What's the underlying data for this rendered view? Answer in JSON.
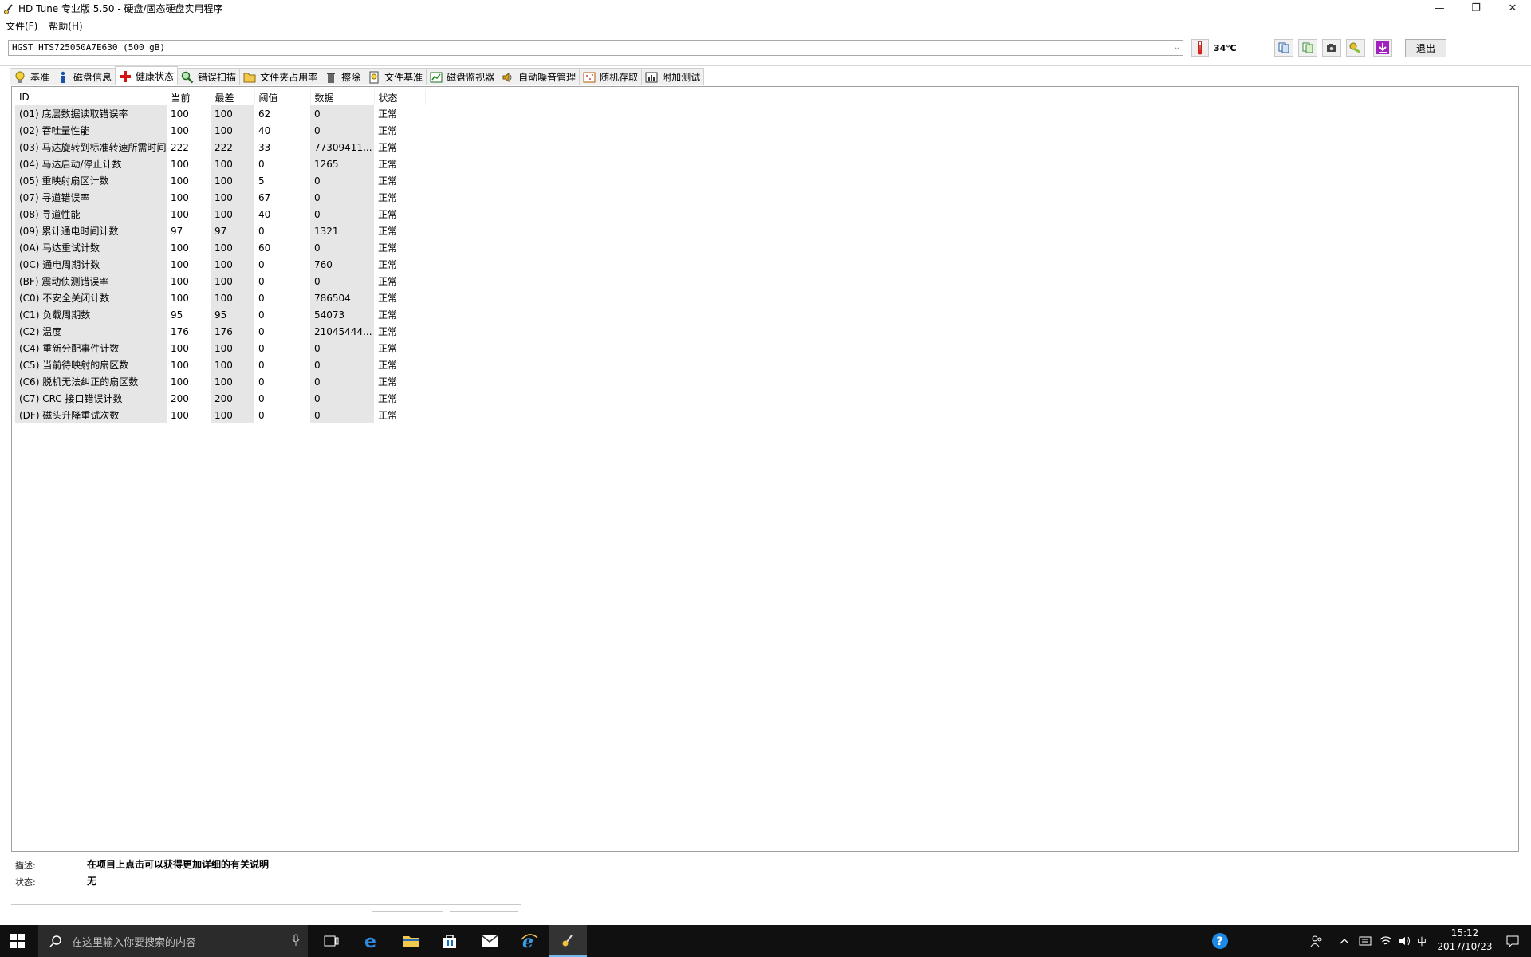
{
  "window": {
    "title": "HD Tune 专业版 5.50 - 硬盘/固态硬盘实用程序",
    "minimize_glyph": "—",
    "restore_glyph": "❐",
    "close_glyph": "✕"
  },
  "menu": {
    "file": "文件(F)",
    "help": "帮助(H)"
  },
  "drivebar": {
    "selected_drive": "HGST HTS725050A7E630 (500 gB)",
    "temperature": "34℃",
    "exit_label": "退出"
  },
  "tabs": [
    {
      "label": "基准",
      "icon": "lightbulb-icon"
    },
    {
      "label": "磁盘信息",
      "icon": "info-icon"
    },
    {
      "label": "健康状态",
      "icon": "red-cross-icon",
      "active": true
    },
    {
      "label": "错误扫描",
      "icon": "magnifier-icon"
    },
    {
      "label": "文件夹占用率",
      "icon": "folder-icon"
    },
    {
      "label": "擦除",
      "icon": "trash-icon"
    },
    {
      "label": "文件基准",
      "icon": "file-benchmark-icon"
    },
    {
      "label": "磁盘监视器",
      "icon": "monitor-chart-icon"
    },
    {
      "label": "自动噪音管理",
      "icon": "speaker-icon"
    },
    {
      "label": "随机存取",
      "icon": "random-access-icon"
    },
    {
      "label": "附加测试",
      "icon": "extra-tests-icon"
    }
  ],
  "table": {
    "headers": {
      "id": "ID",
      "current": "当前",
      "worst": "最差",
      "threshold": "阈值",
      "data": "数据",
      "status": "状态"
    },
    "rows": [
      {
        "id": "(01) 底层数据读取错误率",
        "current": "100",
        "worst": "100",
        "threshold": "62",
        "data": "0",
        "status": "正常"
      },
      {
        "id": "(02) 吞吐量性能",
        "current": "100",
        "worst": "100",
        "threshold": "40",
        "data": "0",
        "status": "正常"
      },
      {
        "id": "(03) 马达旋转到标准转速所需时间",
        "current": "222",
        "worst": "222",
        "threshold": "33",
        "data": "77309411...",
        "status": "正常"
      },
      {
        "id": "(04) 马达启动/停止计数",
        "current": "100",
        "worst": "100",
        "threshold": "0",
        "data": "1265",
        "status": "正常"
      },
      {
        "id": "(05) 重映射扇区计数",
        "current": "100",
        "worst": "100",
        "threshold": "5",
        "data": "0",
        "status": "正常"
      },
      {
        "id": "(07) 寻道错误率",
        "current": "100",
        "worst": "100",
        "threshold": "67",
        "data": "0",
        "status": "正常"
      },
      {
        "id": "(08) 寻道性能",
        "current": "100",
        "worst": "100",
        "threshold": "40",
        "data": "0",
        "status": "正常"
      },
      {
        "id": "(09) 累计通电时间计数",
        "current": "97",
        "worst": "97",
        "threshold": "0",
        "data": "1321",
        "status": "正常"
      },
      {
        "id": "(0A) 马达重试计数",
        "current": "100",
        "worst": "100",
        "threshold": "60",
        "data": "0",
        "status": "正常"
      },
      {
        "id": "(0C) 通电周期计数",
        "current": "100",
        "worst": "100",
        "threshold": "0",
        "data": "760",
        "status": "正常"
      },
      {
        "id": "(BF) 震动侦测错误率",
        "current": "100",
        "worst": "100",
        "threshold": "0",
        "data": "0",
        "status": "正常"
      },
      {
        "id": "(C0) 不安全关闭计数",
        "current": "100",
        "worst": "100",
        "threshold": "0",
        "data": "786504",
        "status": "正常"
      },
      {
        "id": "(C1) 负载周期数",
        "current": "95",
        "worst": "95",
        "threshold": "0",
        "data": "54073",
        "status": "正常"
      },
      {
        "id": "(C2) 温度",
        "current": "176",
        "worst": "176",
        "threshold": "0",
        "data": "21045444...",
        "status": "正常"
      },
      {
        "id": "(C4) 重新分配事件计数",
        "current": "100",
        "worst": "100",
        "threshold": "0",
        "data": "0",
        "status": "正常"
      },
      {
        "id": "(C5) 当前待映射的扇区数",
        "current": "100",
        "worst": "100",
        "threshold": "0",
        "data": "0",
        "status": "正常"
      },
      {
        "id": "(C6) 脱机无法纠正的扇区数",
        "current": "100",
        "worst": "100",
        "threshold": "0",
        "data": "0",
        "status": "正常"
      },
      {
        "id": "(C7) CRC 接口错误计数",
        "current": "200",
        "worst": "200",
        "threshold": "0",
        "data": "0",
        "status": "正常"
      },
      {
        "id": "(DF) 磁头升降重试次数",
        "current": "100",
        "worst": "100",
        "threshold": "0",
        "data": "0",
        "status": "正常"
      }
    ]
  },
  "description": {
    "desc_label": "描述:",
    "desc_value": "在项目上点击可以获得更加详细的有关说明",
    "status_label": "状态:",
    "status_value": "无"
  },
  "taskbar": {
    "search_placeholder": "在这里输入你要搜索的内容",
    "ime": "中",
    "time": "15:12",
    "date": "2017/10/23"
  }
}
